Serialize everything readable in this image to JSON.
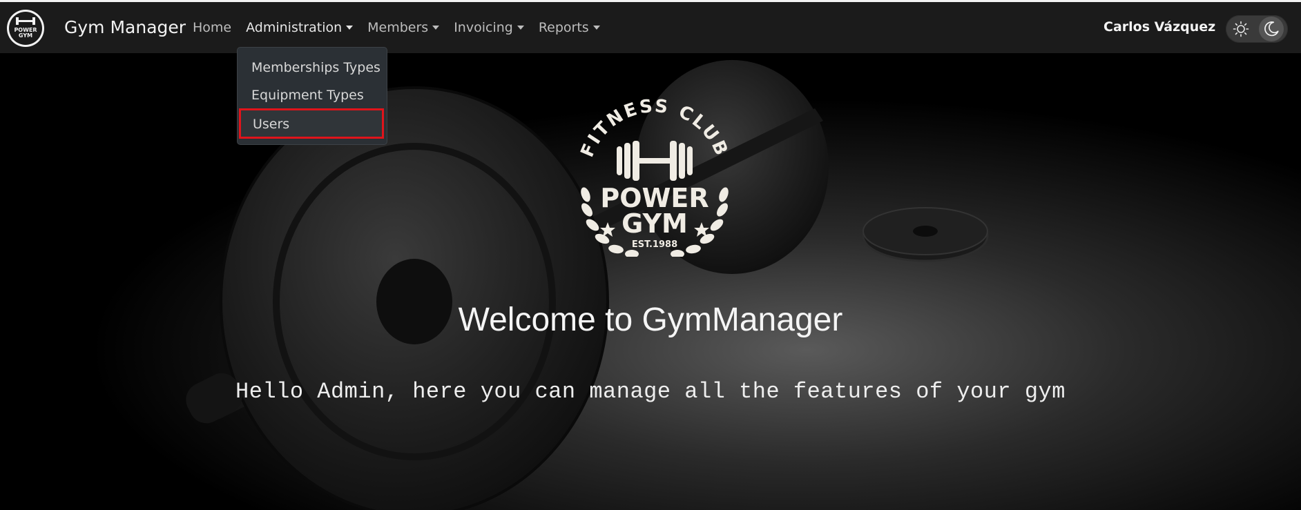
{
  "app": {
    "brand_name": "Gym Manager"
  },
  "nav": {
    "items": [
      {
        "label": "Home",
        "has_caret": false
      },
      {
        "label": "Administration",
        "has_caret": true
      },
      {
        "label": "Members",
        "has_caret": true
      },
      {
        "label": "Invoicing",
        "has_caret": true
      },
      {
        "label": "Reports",
        "has_caret": true
      }
    ],
    "user_name": "Carlos Vázquez"
  },
  "dropdown": {
    "items": [
      {
        "label": "Memberships Types"
      },
      {
        "label": "Equipment Types"
      },
      {
        "label": "Users",
        "highlighted": true
      }
    ],
    "highlight_color": "#e0141b"
  },
  "logo": {
    "arc_text": "FITNESS CLUB",
    "line1": "POWER",
    "line2": "GYM",
    "est": "EST.1988"
  },
  "hero": {
    "title": "Welcome to GymManager",
    "subtitle": "Hello Admin, here you can manage all the features of your gym"
  },
  "theme": {
    "current": "dark",
    "icons": [
      "sun-icon",
      "moon-icon"
    ]
  }
}
